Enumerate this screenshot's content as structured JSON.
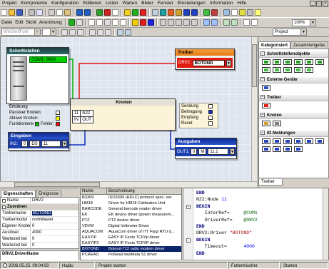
{
  "menu": [
    "Projekt",
    "Komponente",
    "Konfiguration",
    "Editieren",
    "Listen",
    "Warten",
    "Bilder",
    "Fenster",
    "Einstellungen",
    "Information",
    "Hilfe"
  ],
  "toolbar1": {
    "icons": [
      {
        "name": "new-file-icon",
        "color": "#ffffff"
      },
      {
        "name": "open-folder-icon",
        "color": "#f0c040"
      },
      {
        "name": "save-icon",
        "color": "#4060c0"
      },
      {
        "sep": true
      },
      {
        "name": "print-icon",
        "color": "#c0c0c0"
      },
      {
        "name": "preview-icon",
        "color": "#e0e0ff"
      },
      {
        "sep": true
      },
      {
        "name": "cut-icon",
        "color": "#d0d0d0"
      },
      {
        "name": "copy-icon",
        "color": "#ffffff"
      },
      {
        "name": "paste-icon",
        "color": "#e0c080"
      },
      {
        "sep": true
      },
      {
        "name": "undo-icon",
        "color": "#2060c0"
      },
      {
        "name": "redo-icon",
        "color": "#2060c0"
      },
      {
        "sep": true
      },
      {
        "name": "add-component-icon",
        "color": "#30a030"
      },
      {
        "name": "delete-icon",
        "color": "#d02020"
      },
      {
        "name": "properties-icon",
        "color": "#ffffff"
      },
      {
        "sep": true
      },
      {
        "name": "compile-icon",
        "color": "#f0d020"
      },
      {
        "name": "run-icon",
        "color": "#20b020"
      },
      {
        "name": "stop-icon",
        "color": "#e02020"
      },
      {
        "sep": true
      },
      {
        "name": "grid-icon",
        "color": "#c0d0e0"
      },
      {
        "name": "interface-icon",
        "color": "#20a0a0"
      },
      {
        "name": "driver-icon",
        "color": "#e06020"
      },
      {
        "name": "node-icon",
        "color": "#d0a030"
      },
      {
        "name": "input-icon",
        "color": "#2040c0"
      },
      {
        "name": "output-icon",
        "color": "#2040c0"
      },
      {
        "sep": true
      },
      {
        "name": "connect-icon",
        "color": "#40c040"
      },
      {
        "name": "disconnect-icon",
        "color": "#c04040"
      },
      {
        "sep": true
      },
      {
        "name": "monitor-icon",
        "color": "#a0c0e0"
      },
      {
        "name": "list-icon",
        "color": "#ffffff"
      },
      {
        "name": "chart-icon",
        "color": "#e0e040"
      },
      {
        "name": "settings-icon",
        "color": "#c0c0c0"
      },
      {
        "name": "help-icon",
        "color": "#ffff80"
      }
    ]
  },
  "toolbar2": {
    "menus": [
      "Datei",
      "Edit",
      "Sicht",
      "Anordnung"
    ],
    "icons": [
      {
        "name": "run-diagram-icon",
        "color": "#20b020"
      },
      {
        "name": "step-icon",
        "color": "#e0e0e0"
      },
      {
        "sep": true
      },
      {
        "name": "pointer-icon",
        "color": "#ffffff"
      },
      {
        "name": "text-tool-icon",
        "color": "#ffffff"
      },
      {
        "name": "line-tool-icon",
        "color": "#e0e0e0"
      },
      {
        "name": "rectangle-tool-icon",
        "color": "#ffffff"
      },
      {
        "name": "ellipse-tool-icon",
        "color": "#ffffff"
      },
      {
        "sep": true
      },
      {
        "name": "fill-color-icon",
        "color": "#f0d000"
      },
      {
        "name": "line-color-icon",
        "color": "#e02020"
      },
      {
        "name": "font-color-icon",
        "color": "#2020e0"
      },
      {
        "sep": true
      },
      {
        "name": "align-left-icon",
        "color": "#d0d0d0"
      },
      {
        "name": "align-center-icon",
        "color": "#d0d0d0"
      },
      {
        "name": "align-right-icon",
        "color": "#d0d0d0"
      },
      {
        "name": "align-top-icon",
        "color": "#d0d0d0"
      },
      {
        "name": "align-bottom-icon",
        "color": "#d0d0d0"
      },
      {
        "sep": true
      },
      {
        "name": "bring-front-icon",
        "color": "#a0c0ff"
      },
      {
        "name": "send-back-icon",
        "color": "#a0c0ff"
      },
      {
        "sep": true
      },
      {
        "name": "group-icon",
        "color": "#c0e0c0"
      },
      {
        "name": "ungroup-icon",
        "color": "#c0e0c0"
      },
      {
        "sep": true
      },
      {
        "name": "zoom-in-icon",
        "color": "#ffffff"
      },
      {
        "name": "zoom-out-icon",
        "color": "#ffffff"
      }
    ],
    "zoom": "100%"
  },
  "toolbar3": {
    "font": "WinSerifFont",
    "icons": [
      {
        "name": "bold-icon",
        "color": "#e0e0e0"
      },
      {
        "name": "italic-icon",
        "color": "#e0e0e0"
      },
      {
        "name": "underline-icon",
        "color": "#e0e0e0"
      },
      {
        "sep": true
      },
      {
        "name": "text-left-icon",
        "color": "#e0e0e0"
      },
      {
        "name": "text-center-icon",
        "color": "#e0e0e0"
      },
      {
        "name": "text-right-icon",
        "color": "#e0e0e0"
      },
      {
        "sep": true
      },
      {
        "name": "grid-toggle-icon",
        "color": "#c0d0e0"
      },
      {
        "name": "snap-icon",
        "color": "#c0d0e0"
      }
    ],
    "project": "Project"
  },
  "canvas": {
    "schnittstellen": {
      "title": "Schnittstellen",
      "field": "COM1: 9600"
    },
    "legend": {
      "title": "Erklärung",
      "passive": "Passiver Knoten:",
      "active": "Aktiver Knoten:",
      "ok": "Funktionieren",
      "error": "Fehler:",
      "colors": {
        "passive": "#ffffff",
        "active": "#ffff00",
        "ok": "#00c000",
        "error": "#ff0000"
      }
    },
    "eingaben": {
      "title": "Eingaben",
      "label": "IN2:",
      "v1": "0",
      "v2": "DS",
      "v3": "11"
    },
    "treiber": {
      "title": "Treiber",
      "label": "DRV2:",
      "value": "BOTOND"
    },
    "knoten": {
      "title": "Knoten",
      "id": "11",
      "name": "N22",
      "in": "IN",
      "out": "OUT"
    },
    "signals": [
      {
        "label": "Sendung",
        "color": "#ffffff"
      },
      {
        "label": "Beitragung",
        "color": "#1030c0"
      },
      {
        "label": "Empfang",
        "color": "#ffffff"
      },
      {
        "label": "Reset",
        "color": "#ffffff"
      }
    ],
    "ausgaben": {
      "title": "Ausgaben",
      "label": "OUT1:",
      "v1": "0",
      "v2": "M",
      "v3": "11.1"
    }
  },
  "palette": {
    "tabs": [
      "Kategorisiert",
      "Zusammengefas"
    ],
    "sections": [
      {
        "title": "Schnittstellenobjekte",
        "icons": [
          {
            "name": "serial-port-icon",
            "color": "#20a020"
          },
          {
            "name": "tcp-port-icon",
            "color": "#20a020"
          },
          {
            "name": "modem-icon",
            "color": "#20a020"
          },
          {
            "name": "radio-icon",
            "color": "#20a020"
          },
          {
            "name": "bus-icon",
            "color": "#20a020"
          },
          {
            "name": "usb-icon",
            "color": "#20a020"
          },
          {
            "name": "gateway-icon",
            "color": "#40c040"
          },
          {
            "name": "router-icon",
            "color": "#40c040"
          },
          {
            "name": "hub-icon",
            "color": "#40c040"
          },
          {
            "name": "converter-icon",
            "color": "#40c040"
          },
          {
            "name": "link-icon",
            "color": "#40c040"
          }
        ]
      },
      {
        "title": "Externe Geräte",
        "icons": [
          {
            "name": "external-device-icon",
            "color": "#2050c0"
          }
        ]
      },
      {
        "title": "Treiber",
        "icons": [
          {
            "name": "driver-object-icon",
            "color": "#e02010"
          }
        ]
      },
      {
        "title": "Knoten",
        "icons": [
          {
            "name": "node-object-icon",
            "color": "#d0a030"
          },
          {
            "name": "node-group-icon",
            "color": "#808080"
          }
        ]
      },
      {
        "title": "IO Meldungen",
        "icons": [
          {
            "name": "io-dps-icon",
            "color": "#2040c0"
          },
          {
            "name": "io-rpd-icon",
            "color": "#2040c0"
          },
          {
            "name": "io-di-icon",
            "color": "#2040c0"
          },
          {
            "name": "io-do-icon",
            "color": "#2040c0"
          },
          {
            "name": "io-ai-icon",
            "color": "#2040c0"
          },
          {
            "name": "io-ao-icon",
            "color": "#2040c0"
          },
          {
            "name": "io-cnt-icon",
            "color": "#2040c0"
          },
          {
            "name": "io-cmd-icon",
            "color": "#2040c0"
          },
          {
            "name": "io-set-icon",
            "color": "#2040c0"
          },
          {
            "name": "io-str-icon",
            "color": "#2040c0"
          }
        ]
      }
    ],
    "bottom_tab": "Treiber"
  },
  "properties": {
    "tabs": [
      "Eigenschaften",
      "Ereignisse"
    ],
    "rows": [
      {
        "label": "Name",
        "value": "DRV2",
        "kind": "plain"
      },
      {
        "label": "Zuordnen",
        "value": "",
        "kind": "section"
      },
      {
        "label": "Treibername",
        "value": "BOTOND",
        "kind": "selected"
      },
      {
        "label": "Treibermodul",
        "value": "comMaster",
        "kind": "plain"
      },
      {
        "label": "Eigener Knoten",
        "value": "0",
        "kind": "plain"
      },
      {
        "label": "Auslöser",
        "value": "4000",
        "kind": "plain"
      },
      {
        "label": "Wartezeit bei",
        "value": "0",
        "kind": "plain"
      },
      {
        "label": "Wartezeit bei",
        "value": "0",
        "kind": "plain"
      }
    ],
    "footer": "DRV2.DriverName"
  },
  "driver_list": {
    "columns": [
      "Name",
      "Beschreibung"
    ],
    "selected": 9,
    "rows": [
      {
        "name": "B3309",
        "desc": "ISO3309 (HDLC) protocol spec. ver."
      },
      {
        "name": "HM18",
        "desc": "Driver for HM18 Calibration Unit"
      },
      {
        "name": "BARCODE",
        "desc": "General barcode reader driver"
      },
      {
        "name": "EK",
        "desc": "EK device driver (power measurem..."
      },
      {
        "name": "PTZ",
        "desc": "PTZ device driver"
      },
      {
        "name": "VDVM",
        "desc": "Digital Voltmeter Driver"
      },
      {
        "name": "AQUACOM",
        "desc": "AquaCom driver of ITT Flygt RTU d..."
      },
      {
        "name": "EASYIP",
        "desc": "EASY IP Festo TCP/Ip driver"
      },
      {
        "name": "EASYIP2",
        "desc": "EASY IP Festo TCP/IP driver"
      },
      {
        "name": "BOTOND",
        "desc": "Botond-712 radio modem driver"
      },
      {
        "name": "PCREAD",
        "desc": "PcRead multidata S1 driver"
      }
    ]
  },
  "code": {
    "lines": [
      {
        "fold": false,
        "segments": [
          {
            "text": "END",
            "style": "kw"
          }
        ]
      },
      {
        "fold": false,
        "segments": [
          {
            "text": "N22:Node ",
            "style": "id"
          },
          {
            "text": "11",
            "style": "num"
          }
        ]
      },
      {
        "fold": true,
        "segments": [
          {
            "text": "BEGIN",
            "style": "kw"
          }
        ]
      },
      {
        "fold": false,
        "segments": [
          {
            "text": "   InterRef=     ",
            "style": "id"
          },
          {
            "text": "@COM1",
            "style": "ref"
          }
        ]
      },
      {
        "fold": false,
        "segments": [
          {
            "text": "   DriverRef=    ",
            "style": "id"
          },
          {
            "text": "@DRV2",
            "style": "ref"
          }
        ]
      },
      {
        "fold": false,
        "segments": [
          {
            "text": "END",
            "style": "kw"
          }
        ]
      },
      {
        "fold": false,
        "segments": [
          {
            "text": "DRV2:Driver ",
            "style": "id"
          },
          {
            "text": "\"BOTOND\"",
            "style": "str"
          }
        ]
      },
      {
        "fold": true,
        "segments": [
          {
            "text": "BEGIN",
            "style": "kw"
          }
        ]
      },
      {
        "fold": false,
        "segments": [
          {
            "text": "   Timeout=      ",
            "style": "id"
          },
          {
            "text": "4000",
            "style": "num"
          }
        ]
      },
      {
        "fold": false,
        "segments": [
          {
            "text": "END",
            "style": "kw"
          }
        ]
      }
    ]
  },
  "status": [
    {
      "text": "2006.05.25. 09:04:50",
      "icon": "clock-icon"
    },
    {
      "text": "Hajdu"
    },
    {
      "text": "Projekt starten"
    },
    {
      "text": "Futtermischer"
    },
    {
      "text": "Starten"
    }
  ]
}
